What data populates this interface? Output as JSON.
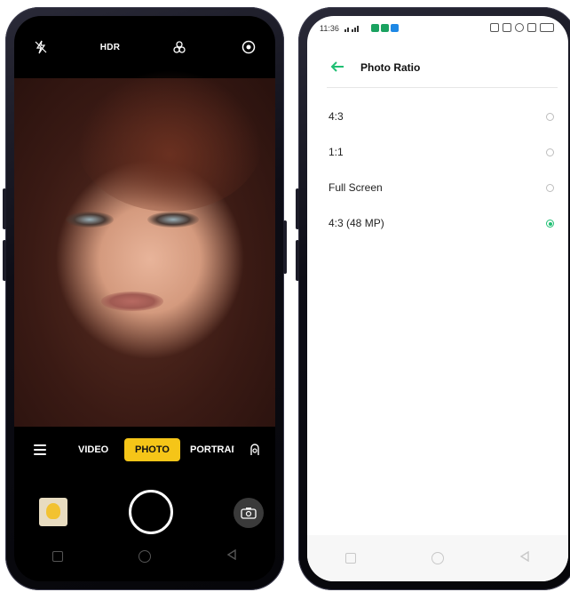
{
  "camera": {
    "hdr_label": "HDR",
    "modes": [
      "VIDEO",
      "PHOTO",
      "PORTRAIT"
    ],
    "active_mode": "PHOTO",
    "icons": [
      "flash-off-icon",
      "filter-icon",
      "settings-icon",
      "menu-icon",
      "lens-icon",
      "switch-camera-icon"
    ]
  },
  "settings": {
    "status_time": "11:36",
    "status_app_colors": [
      "#1aa260",
      "#1aa260",
      "#1e88e5"
    ],
    "back_icon": "back-arrow-icon",
    "title": "Photo Ratio",
    "options": [
      {
        "label": "4:3",
        "selected": false
      },
      {
        "label": "1:1",
        "selected": false
      },
      {
        "label": "Full Screen",
        "selected": false
      },
      {
        "label": "4:3 (48 MP)",
        "selected": true
      }
    ],
    "accent_color": "#1fbf73"
  }
}
